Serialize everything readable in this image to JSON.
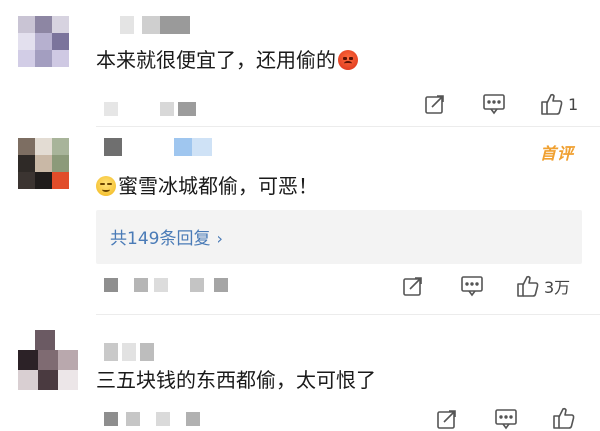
{
  "comments": [
    {
      "text": "本来就很便宜了，还用偷的",
      "emoji": "angry-face-emoji",
      "actions": {
        "like_count": "1"
      },
      "hot_badge": ""
    },
    {
      "text": "蜜雪冰城都偷，可恶！",
      "emoji": "shy-face-emoji",
      "actions": {
        "like_count": "3万"
      },
      "hot_badge": "首评",
      "replies_label": "共149条回复",
      "replies_chevron": "›"
    },
    {
      "text": "三五块钱的东西都偷，太可恨了",
      "actions": {
        "like_count": ""
      },
      "hot_badge": ""
    }
  ],
  "icons": {
    "forward": "share-square-icon",
    "comment": "comment-bubble-icon",
    "like": "thumbs-up-icon"
  },
  "colors": {
    "link": "#4a7bb7",
    "hot_badge": "#f0a030",
    "reply_bg": "#f3f3f3"
  }
}
